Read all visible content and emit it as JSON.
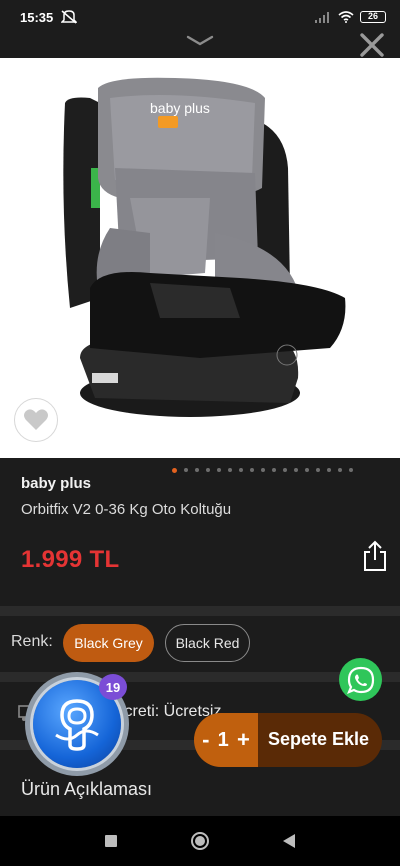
{
  "status": {
    "time": "15:35",
    "battery": "26"
  },
  "product": {
    "brand": "baby plus",
    "name": "Orbitfix V2 0-36 Kg Oto Koltuğu",
    "price": "1.999 TL",
    "image_branding": "baby plus"
  },
  "gallery": {
    "dot_count": 17,
    "active_index": 0
  },
  "variant": {
    "label": "Renk:",
    "options": [
      {
        "label": "Black Grey",
        "selected": true
      },
      {
        "label": "Black Red",
        "selected": false
      }
    ]
  },
  "shipping": {
    "text": "Ücreti:  Ücretsiz"
  },
  "description": {
    "title": "Ürün Açıklaması"
  },
  "chat": {
    "badge_count": "19"
  },
  "cart": {
    "minus": "-",
    "quantity": "1",
    "plus": "+",
    "add_label": "Sepete Ekle"
  },
  "colors": {
    "accent": "#bf5b11",
    "price": "#e53434",
    "whatsapp": "#2fc65a",
    "chat_bubble": "#1565d8",
    "badge": "#7b4dd6"
  }
}
